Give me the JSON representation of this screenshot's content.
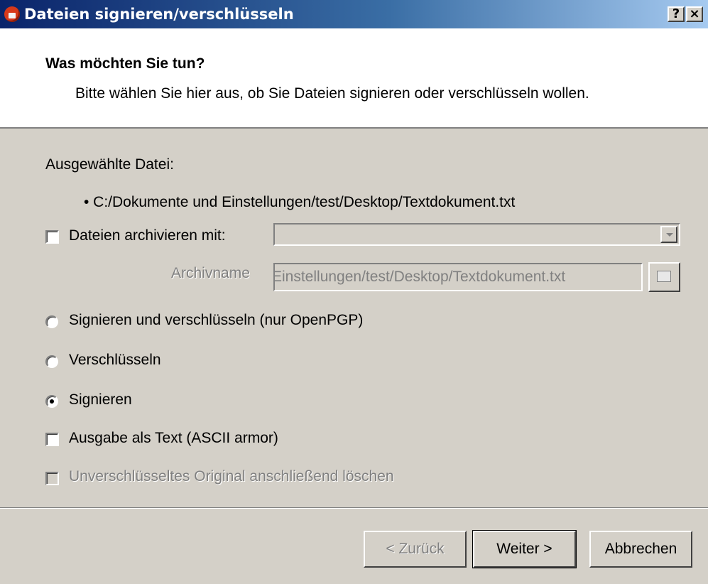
{
  "window": {
    "title": "Dateien signieren/verschlüsseln",
    "help_button": "?",
    "close_button": "×",
    "app_icon": "kleopatra-icon"
  },
  "header": {
    "title": "Was möchten Sie tun?",
    "description": "Bitte wählen Sie hier aus, ob Sie Dateien signieren oder verschlüsseln wollen."
  },
  "selection": {
    "label": "Ausgewählte Datei:",
    "files": [
      "• C:/Dokumente und Einstellungen/test/Desktop/Textdokument.txt"
    ]
  },
  "archive": {
    "checkbox_label": "Dateien archivieren mit:",
    "checked": false,
    "combo_value": "",
    "name_label": "Archivname",
    "name_value": "Einstellungen/test/Desktop/Textdokument.txt",
    "browse_icon": "browse-icon"
  },
  "options": {
    "radio_sign_encrypt": "Signieren und verschlüsseln (nur OpenPGP)",
    "radio_encrypt": "Verschlüsseln",
    "radio_sign": "Signieren",
    "selected": "Signieren",
    "armor_label": "Ausgabe als Text (ASCII armor)",
    "armor_checked": false,
    "delete_original_label": "Unverschlüsseltes Original anschließend löschen",
    "delete_original_checked": false
  },
  "buttons": {
    "back": "< Zurück",
    "next": "Weiter >",
    "cancel": "Abbrechen"
  },
  "colors": {
    "titlebar_start": "#0a246a",
    "titlebar_end": "#a6caf0",
    "dialog_bg": "#d4d0c8",
    "header_bg": "#ffffff"
  }
}
